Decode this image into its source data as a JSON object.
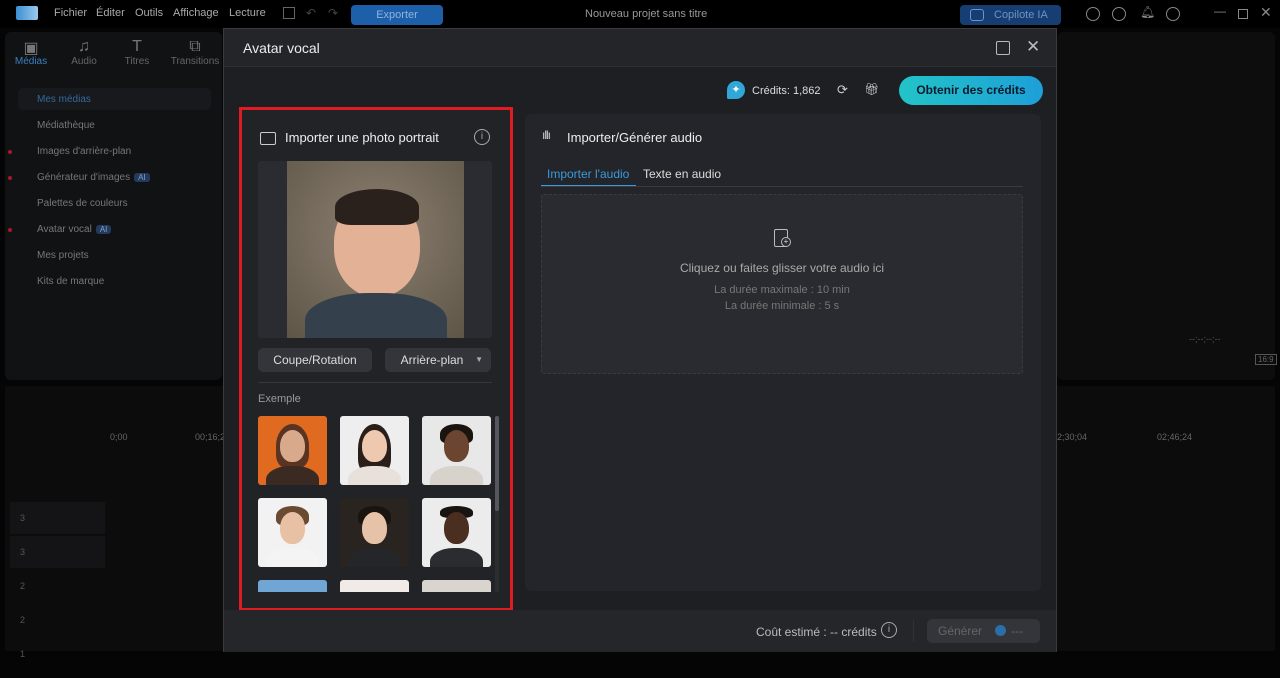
{
  "app": {
    "menu": [
      "Fichier",
      "Éditer",
      "Outils",
      "Affichage",
      "Lecture"
    ],
    "export_label": "Exporter",
    "project_title": "Nouveau projet sans titre",
    "copilot_label": "Copilote IA"
  },
  "media_tabs": [
    {
      "label": "Médias",
      "icon": "media-icon"
    },
    {
      "label": "Audio",
      "icon": "music-icon"
    },
    {
      "label": "Titres",
      "icon": "title-icon"
    },
    {
      "label": "Transitions",
      "icon": "transition-icon"
    }
  ],
  "sidebar": {
    "items": [
      {
        "label": "Mes médias",
        "active": true
      },
      {
        "label": "Médiathèque"
      },
      {
        "label": "Images d'arrière-plan"
      },
      {
        "label": "Générateur d'images",
        "badge": "AI"
      },
      {
        "label": "Palettes de couleurs"
      },
      {
        "label": "Avatar vocal",
        "badge": "AI"
      },
      {
        "label": "Mes projets"
      },
      {
        "label": "Kits de marque"
      }
    ]
  },
  "timeline": {
    "ticks": [
      "0;00",
      "00;16;2",
      "2;30;04",
      "02;46;24"
    ],
    "tracks": [
      "3",
      "3",
      "2",
      "2",
      "1"
    ],
    "aspect": "16:9",
    "timecode": "--;--;--;--"
  },
  "modal": {
    "title": "Avatar vocal",
    "credits_label": "Crédits: 1,862",
    "get_credits_label": "Obtenir des crédits",
    "portrait": {
      "title": "Importer une photo portrait",
      "crop_label": "Coupe/Rotation",
      "background_label": "Arrière-plan",
      "example_label": "Exemple"
    },
    "audio": {
      "title": "Importer/Générer audio",
      "tabs": [
        "Importer l'audio",
        "Texte en audio"
      ],
      "active_tab": 0,
      "drop_text": "Cliquez ou faites glisser votre audio ici",
      "max_duration": "La durée maximale : 10 min",
      "min_duration": "La durée minimale : 5 s"
    },
    "footer": {
      "cost_label": "Coût estimé : -- crédits",
      "generate_label": "Générer",
      "generate_cost": "---"
    }
  },
  "colors": {
    "accent": "#1e9fd8",
    "highlight_border": "#e01b24",
    "active_tab": "#3a9ad9"
  }
}
